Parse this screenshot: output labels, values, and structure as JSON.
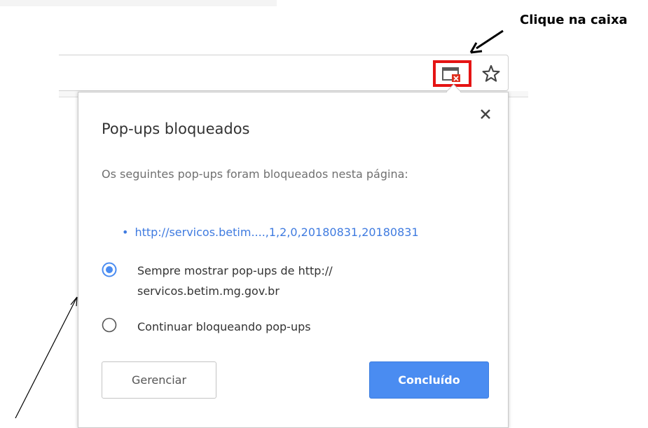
{
  "annotation": {
    "label": "Clique na caixa"
  },
  "dialog": {
    "title": "Pop-ups bloqueados",
    "description": "Os seguintes pop-ups foram bloqueados nesta página:",
    "blocked_item": {
      "bullet": "•",
      "url": "http://servicos.betim....,1,2,0,20180831,20180831"
    },
    "options": [
      {
        "label_line1": "Sempre mostrar pop-ups de http://",
        "label_line2": "servicos.betim.mg.gov.br",
        "selected": true
      },
      {
        "label_line1": "Continuar bloqueando pop-ups",
        "selected": false
      }
    ],
    "manage_button": "Gerenciar",
    "done_button": "Concluído"
  },
  "colors": {
    "accent": "#4a8cf1",
    "link": "#3f7be0",
    "highlight_box": "#e51414"
  },
  "icons": [
    "popup-blocked-icon",
    "star-icon",
    "close-icon",
    "radio-selected-icon",
    "radio-unselected-icon"
  ]
}
